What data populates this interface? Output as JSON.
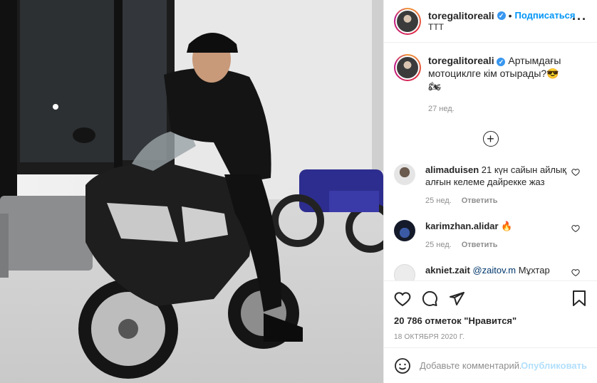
{
  "post": {
    "username": "toregalitoreali",
    "verified_badge": "✓",
    "separator": "•",
    "follow_label": "Подписаться",
    "location": "TTT",
    "more_label": "···"
  },
  "caption": {
    "username": "toregalitoreali",
    "text": "Артымдағы мотоциклге кім отырады?😎🏍",
    "age": "27 нед."
  },
  "load_more_label": "+",
  "comments": [
    {
      "user": "alimaduisen",
      "text": "21 күн сайын айлық алғын келеме дайрекке жаз",
      "age": "25 нед.",
      "reply": "Ответить"
    },
    {
      "user": "karimzhan.alidar",
      "text": "🔥",
      "age": "25 нед.",
      "reply": "Ответить"
    },
    {
      "user": "akniet.zait",
      "mention": "@zaitov.m",
      "text": "Мұхтар отырады...",
      "age": "",
      "reply": ""
    }
  ],
  "stats": {
    "likes": "20 786 отметок \"Нравится\"",
    "date": "18 ОКТЯБРЯ 2020 Г."
  },
  "compose": {
    "placeholder": "Добавьте комментарий...",
    "publish_label": "Опубликовать"
  },
  "icons": [
    "heart-icon",
    "comment-icon",
    "share-icon",
    "bookmark-icon",
    "emoji-icon",
    "more-icon"
  ],
  "colors": {
    "follow": "#0095f6",
    "verified": "#3897f0",
    "publish_disabled": "#b2dffc",
    "meta": "#8e8e8e"
  }
}
